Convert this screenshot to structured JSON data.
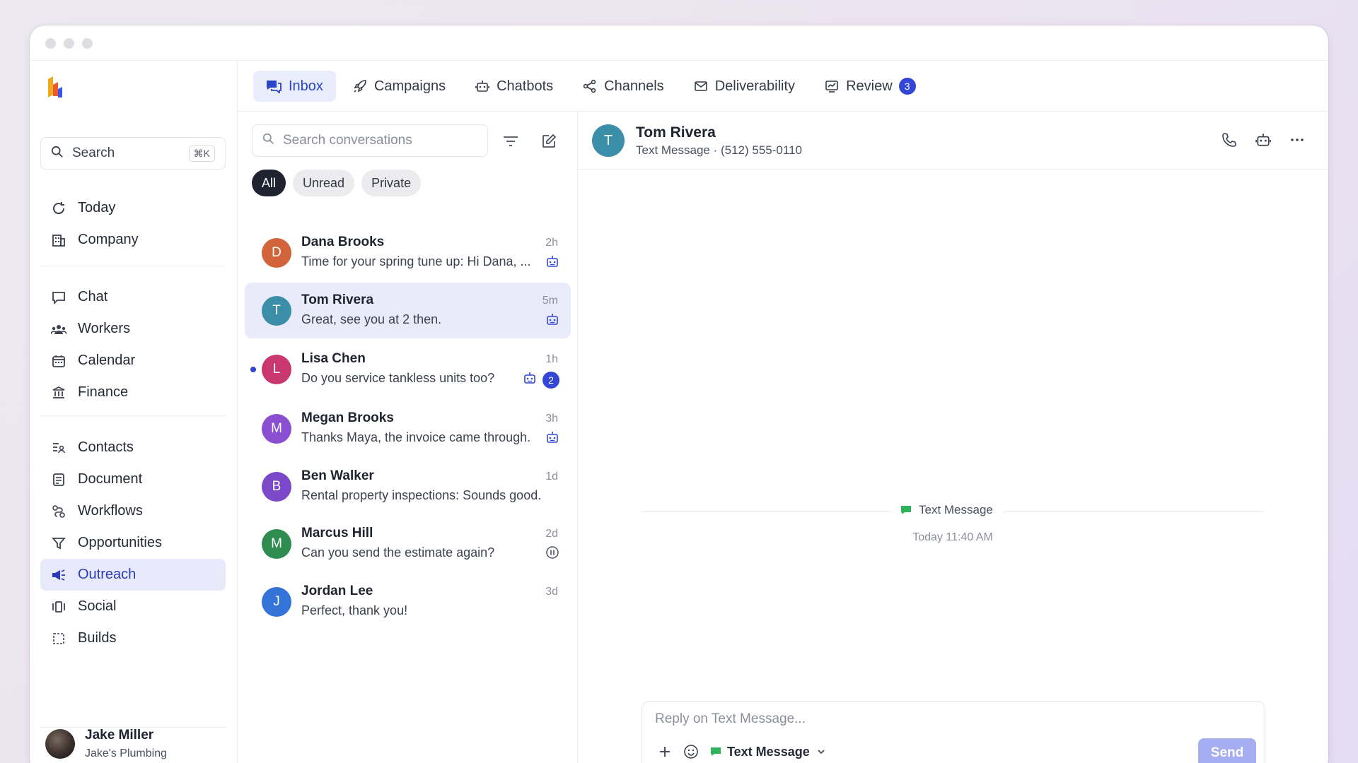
{
  "sidebar": {
    "search_label": "Search",
    "search_shortcut": "⌘K",
    "group1": [
      {
        "label": "Today",
        "icon": "refresh-icon"
      },
      {
        "label": "Company",
        "icon": "building-icon"
      }
    ],
    "group2": [
      {
        "label": "Chat",
        "icon": "chat-bubble-icon"
      },
      {
        "label": "Workers",
        "icon": "users-icon"
      },
      {
        "label": "Calendar",
        "icon": "calendar-icon"
      },
      {
        "label": "Finance",
        "icon": "bank-icon"
      }
    ],
    "group3": [
      {
        "label": "Contacts",
        "icon": "contacts-icon"
      },
      {
        "label": "Document",
        "icon": "document-icon"
      },
      {
        "label": "Workflows",
        "icon": "workflow-icon"
      },
      {
        "label": "Opportunities",
        "icon": "filter-funnel-icon"
      },
      {
        "label": "Outreach",
        "icon": "megaphone-icon",
        "active": true
      },
      {
        "label": "Social",
        "icon": "social-icon"
      },
      {
        "label": "Builds",
        "icon": "builds-icon"
      }
    ],
    "user": {
      "name": "Jake Miller",
      "company": "Jake's Plumbing"
    }
  },
  "tabs": [
    {
      "label": "Inbox",
      "icon": "inbox-icon",
      "active": true
    },
    {
      "label": "Campaigns",
      "icon": "rocket-icon"
    },
    {
      "label": "Chatbots",
      "icon": "bot-icon"
    },
    {
      "label": "Channels",
      "icon": "share-icon"
    },
    {
      "label": "Deliverability",
      "icon": "mail-check-icon"
    },
    {
      "label": "Review",
      "icon": "review-icon",
      "badge": "3"
    }
  ],
  "conversation_list": {
    "search_placeholder": "Search conversations",
    "filters": [
      "All",
      "Unread",
      "Private"
    ],
    "active_filter": "All",
    "items": [
      {
        "name": "Dana Brooks",
        "initial": "D",
        "preview": "Time for your spring tune up: Hi Dana, ...",
        "time": "2h",
        "color": "#d2643c",
        "bot": true
      },
      {
        "name": "Tom Rivera",
        "initial": "T",
        "preview": "Great, see you at 2 then.",
        "time": "5m",
        "color": "#3a8ea8",
        "bot": true,
        "selected": true
      },
      {
        "name": "Lisa Chen",
        "initial": "L",
        "preview": "Do you service tankless units too?",
        "time": "1h",
        "color": "#c8386e",
        "bot": true,
        "unread": "2"
      },
      {
        "name": "Megan Brooks",
        "initial": "M",
        "preview": "Thanks Maya, the invoice came through.",
        "time": "3h",
        "color": "#8a4fd0",
        "bot": true
      },
      {
        "name": "Ben Walker",
        "initial": "B",
        "preview": "Rental property inspections: Sounds good.",
        "time": "1d",
        "color": "#7a48c8"
      },
      {
        "name": "Marcus Hill",
        "initial": "M",
        "preview": "Can you send the estimate again?",
        "time": "2d",
        "color": "#2e8c4e",
        "paused": true
      },
      {
        "name": "Jordan Lee",
        "initial": "J",
        "preview": "Perfect, thank you!",
        "time": "3d",
        "color": "#3474d8"
      }
    ]
  },
  "chat": {
    "contact_name": "Tom Rivera",
    "contact_initial": "T",
    "contact_sub": "Text Message · (512) 555-0110",
    "system_channel": "Text Message",
    "system_time": "Today 11:40 AM",
    "composer_placeholder": "Reply on Text Message...",
    "channel_select": "Text Message",
    "send_label": "Send"
  },
  "colors": {
    "accent": "#3446d6",
    "active_bg": "#e8eafb",
    "send_disabled": "#a6adf0",
    "sms_green": "#2fb35a"
  }
}
